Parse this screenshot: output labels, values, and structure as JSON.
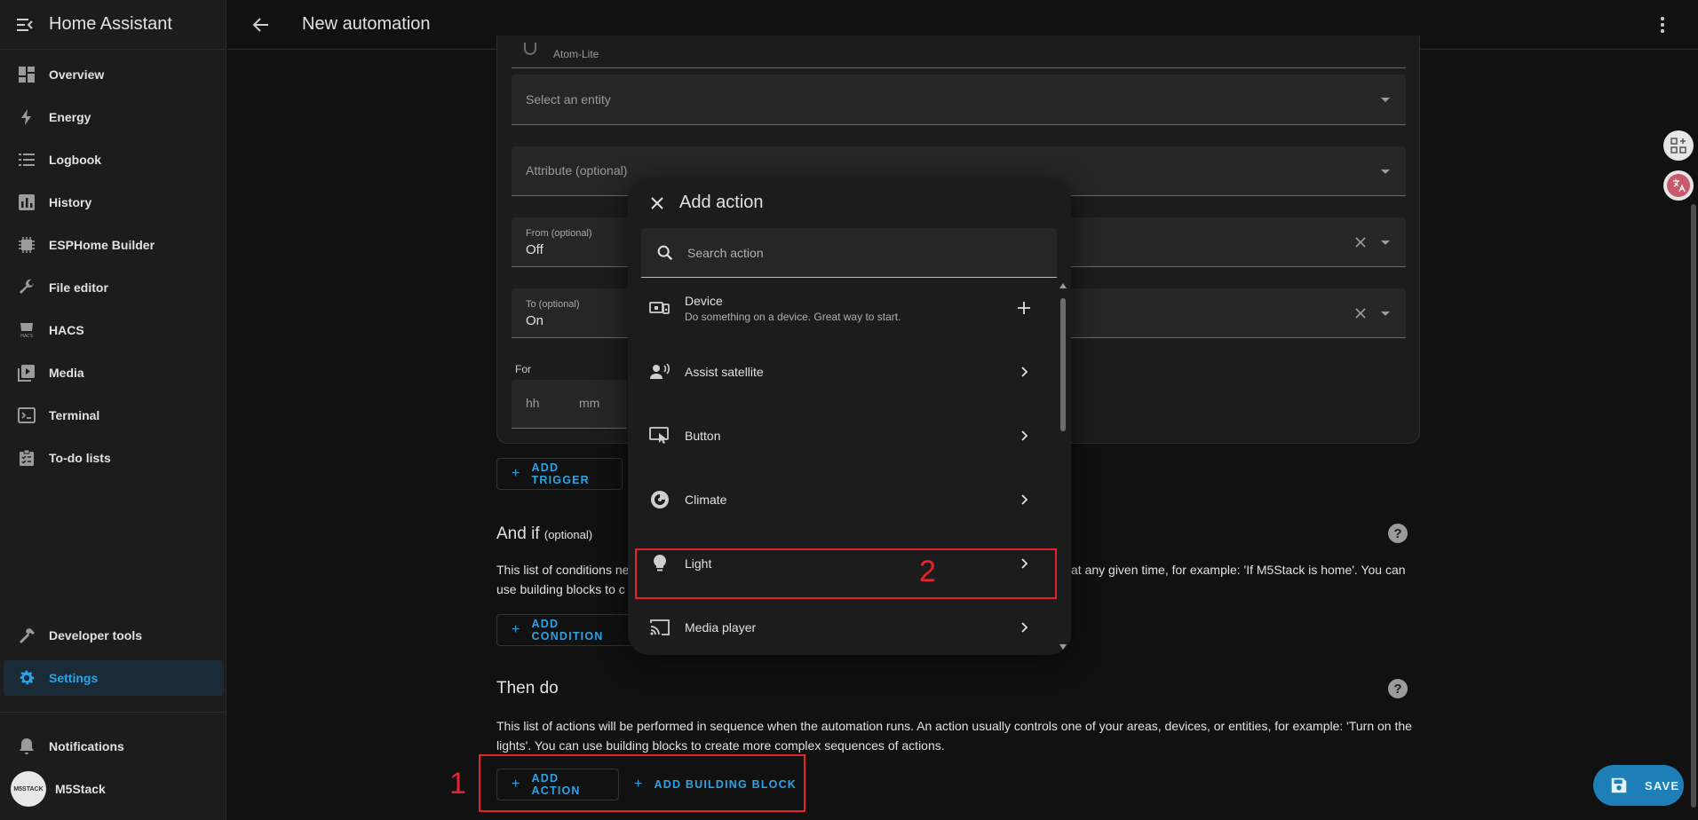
{
  "app": {
    "title": "Home Assistant"
  },
  "sidebar": {
    "items": [
      {
        "label": "Overview",
        "icon": "dashboard-icon"
      },
      {
        "label": "Energy",
        "icon": "lightning-icon"
      },
      {
        "label": "Logbook",
        "icon": "list-icon"
      },
      {
        "label": "History",
        "icon": "chart-icon"
      },
      {
        "label": "ESPHome Builder",
        "icon": "chip-icon"
      },
      {
        "label": "File editor",
        "icon": "wrench-icon"
      },
      {
        "label": "HACS",
        "icon": "hacs-icon"
      },
      {
        "label": "Media",
        "icon": "play-icon"
      },
      {
        "label": "Terminal",
        "icon": "terminal-icon"
      },
      {
        "label": "To-do lists",
        "icon": "clipboard-icon"
      }
    ],
    "developer_tools": "Developer tools",
    "settings": "Settings",
    "notifications": "Notifications",
    "user": "M5Stack",
    "avatar_text": "M5STACK"
  },
  "topbar": {
    "title": "New automation"
  },
  "trigger_form": {
    "device_sub": "Atom-Lite",
    "entity_placeholder": "Select an entity",
    "attribute_placeholder": "Attribute (optional)",
    "from_label": "From (optional)",
    "from_value": "Off",
    "to_label": "To (optional)",
    "to_value": "On",
    "for_label": "For",
    "hh": "hh",
    "mm": "mm"
  },
  "buttons": {
    "add_trigger": "ADD TRIGGER",
    "add_condition": "ADD CONDITION",
    "add_action": "ADD ACTION",
    "add_building_block": "ADD BUILDING BLOCK",
    "save": "SAVE"
  },
  "and_if": {
    "title": "And if",
    "optional": "(optional)",
    "text_left_line1": "This list of conditions ne",
    "text_right_line1": "at any given time, for example: 'If M5Stack is home'. You can",
    "text_left_line2": "use building blocks to c"
  },
  "then_do": {
    "title": "Then do",
    "text": "This list of actions will be performed in sequence when the automation runs. An action usually controls one of your areas, devices, or entities, for example: 'Turn on the lights'. You can use building blocks to create more complex sequences of actions."
  },
  "dialog": {
    "title": "Add action",
    "search_placeholder": "Search action",
    "items": [
      {
        "name": "Device",
        "desc": "Do something on a device. Great way to start.",
        "icon": "device-icon",
        "trailing": "plus"
      },
      {
        "name": "Assist satellite",
        "desc": "",
        "icon": "assist-satellite-icon",
        "trailing": "chevron"
      },
      {
        "name": "Button",
        "desc": "",
        "icon": "button-icon",
        "trailing": "chevron"
      },
      {
        "name": "Climate",
        "desc": "",
        "icon": "climate-icon",
        "trailing": "chevron"
      },
      {
        "name": "Light",
        "desc": "",
        "icon": "bulb-icon",
        "trailing": "chevron"
      },
      {
        "name": "Media player",
        "desc": "",
        "icon": "cast-icon",
        "trailing": "chevron"
      }
    ]
  },
  "annotations": {
    "one": "1",
    "two": "2"
  },
  "colors": {
    "accent": "#2ba3e6",
    "annotation": "#e8222b",
    "background": "#111111",
    "card": "#1c1c1c"
  }
}
